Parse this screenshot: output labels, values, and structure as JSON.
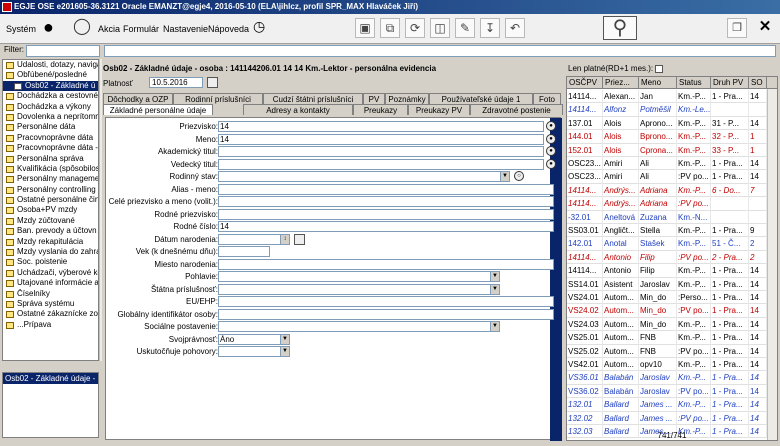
{
  "window": {
    "title": "EGJE OSE e201605-36.3121 Oracle EMANZT@egje4, 2016-05-10  (ELA\\jihlcz, profil SPR_MAX Hlaváček Jiří)"
  },
  "menu": {
    "system": "Systém",
    "akcia": "Akcia",
    "formular": "Formulár",
    "nastavenie": "Nastavenie",
    "napoveda": "Nápoveda"
  },
  "filter": {
    "label": "Filter:"
  },
  "nav_tree": [
    {
      "label": "Udalosti, dotazy, navigá",
      "level": 0
    },
    {
      "label": "Obľúbené/posledné",
      "level": 0
    },
    {
      "label": "Osb02 - Základné ú",
      "level": 1,
      "selected": true
    },
    {
      "label": "Dochádzka a cestovné",
      "level": 0
    },
    {
      "label": "Dochádzka a výkony",
      "level": 0
    },
    {
      "label": "Dovolenka a neprítomn",
      "level": 0
    },
    {
      "label": "Personálne dáta",
      "level": 0
    },
    {
      "label": "Pracovnoprávne dáta",
      "level": 0
    },
    {
      "label": "Pracovnoprávne dáta -",
      "level": 0
    },
    {
      "label": "Personálna správa",
      "level": 0
    },
    {
      "label": "Kvalifikácia (spôsobilost",
      "level": 0
    },
    {
      "label": "Personálny managemer",
      "level": 0
    },
    {
      "label": "Personálny controlling",
      "level": 0
    },
    {
      "label": "Ostatné personálne čin",
      "level": 0
    },
    {
      "label": "Osoba+PV mzdy",
      "level": 0
    },
    {
      "label": "Mzdy zúčtované",
      "level": 0
    },
    {
      "label": "Ban. prevody a účtovn",
      "level": 0
    },
    {
      "label": "Mzdy rekapitulácia",
      "level": 0
    },
    {
      "label": "Mzdy vyslania do zahran",
      "level": 0
    },
    {
      "label": "Soc. poistenie",
      "level": 0
    },
    {
      "label": "Uchádzači, výberové ko",
      "level": 0
    },
    {
      "label": "Utajované informácie a",
      "level": 0
    },
    {
      "label": "Číselníky",
      "level": 0
    },
    {
      "label": "Správa systému",
      "level": 0
    },
    {
      "label": "Ostatné zákaznícke zos",
      "level": 0
    },
    {
      "label": "...Prípava",
      "level": 0
    }
  ],
  "nav_bottom": {
    "current": "Osb02 - Základné údaje -"
  },
  "form": {
    "title": "Osb02 - Základné údaje - osoba : 141144206.01    14    14    Km.-Lektor - personálna evidencia",
    "platnost_label": "Platnosť",
    "platnost_value": "10.5.2016",
    "tabs_row1": [
      "Dôchodky a OZP",
      "Rodinní príslušníci",
      "Cudzí štátni príslušníci",
      "PV",
      "Poznámky",
      "Používateľské údaje 1",
      "Foto"
    ],
    "tabs_row2": [
      "Základné personálne údaje",
      "Adresy a kontakty",
      "Preukazy",
      "Preukazy PV",
      "Zdravotné postenie"
    ],
    "fields": [
      {
        "label": "Priezvisko:",
        "value": "14"
      },
      {
        "label": "Meno:",
        "value": "14"
      },
      {
        "label": "Akademický titul:",
        "value": ""
      },
      {
        "label": "Vedecký titul:",
        "value": ""
      },
      {
        "label": "Rodinný stav:",
        "value": ""
      },
      {
        "label": "Alias - meno:",
        "value": ""
      },
      {
        "label": "Celé priezvisko a meno (volit.):",
        "value": ""
      },
      {
        "label": "Rodné priezvisko:",
        "value": ""
      },
      {
        "label": "Rodné číslo:",
        "value": "14"
      },
      {
        "label": "Dátum narodenia:",
        "value": ""
      },
      {
        "label": "Vek (k dnešnému dňu):",
        "value": ""
      },
      {
        "label": "Miesto narodenia:",
        "value": ""
      },
      {
        "label": "Pohlavie:",
        "value": ""
      },
      {
        "label": "Štátna príslušnosť:",
        "value": ""
      },
      {
        "label": "EU/EHP:",
        "value": ""
      },
      {
        "label": "Globálny identifikátor osoby:",
        "value": ""
      },
      {
        "label": "Sociálne postavenie:",
        "value": ""
      },
      {
        "label": "Svojprávnosť:",
        "value": "Áno"
      },
      {
        "label": "Uskutočňuje pohovory:",
        "value": ""
      }
    ]
  },
  "grid": {
    "len_platne_label": "Len platné(RD+1 mes.):",
    "headers": [
      "OSČPV",
      "Priez...",
      "Meno",
      "Status",
      "Druh PV",
      "SO"
    ],
    "rows": [
      {
        "c": [
          "14114...",
          "Alexan...",
          "Jan",
          "Km.-P...",
          "1 - Pra...",
          "14"
        ],
        "color": "#000"
      },
      {
        "c": [
          "14114...",
          "Alfonz",
          "Potměšil",
          "Km.-Le...",
          "",
          ""
        ],
        "color": "#2040c0",
        "italic": true
      },
      {
        "c": [
          "137.01",
          "Alois",
          "Aprono...",
          "Km.-P...",
          "31 - P...",
          "14"
        ],
        "color": "#000"
      },
      {
        "c": [
          "144.01",
          "Alois",
          "Bprono...",
          "Km.-P...",
          "32 - P...",
          "1"
        ],
        "color": "#c00000"
      },
      {
        "c": [
          "152.01",
          "Alois",
          "Cprona...",
          "Km.-P...",
          "33 - P...",
          "1"
        ],
        "color": "#c00000"
      },
      {
        "c": [
          "OSC23...",
          "Amiri",
          "Ali",
          "Km.-P...",
          "1 - Pra...",
          "14"
        ],
        "color": "#000"
      },
      {
        "c": [
          "OSC23...",
          "Amiri",
          "Ali",
          ":PV po...",
          "1 - Pra...",
          "14"
        ],
        "color": "#000"
      },
      {
        "c": [
          "14114...",
          "Andrýs...",
          "Adriana",
          "Km.-P...",
          "6 - Do...",
          "7"
        ],
        "color": "#c00000",
        "italic": true
      },
      {
        "c": [
          "14114...",
          "Andrýs...",
          "Adriana",
          ":PV po...",
          "",
          ""
        ],
        "color": "#c00000",
        "italic": true
      },
      {
        "c": [
          "-32.01",
          "Aneltová",
          "Zuzana",
          "Km.-N...",
          "",
          ""
        ],
        "color": "#2040c0"
      },
      {
        "c": [
          "SS03.01",
          "Angličt...",
          "Stella",
          "Km.-P...",
          "1 - Pra...",
          "9"
        ],
        "color": "#000"
      },
      {
        "c": [
          "142.01",
          "Anotal",
          "Stašek",
          "Km.-P...",
          "51 - Č...",
          "2"
        ],
        "color": "#2040c0"
      },
      {
        "c": [
          "14114...",
          "Antonio",
          "Filip",
          ":PV po...",
          "2 - Pra...",
          "2"
        ],
        "color": "#c00000",
        "italic": true
      },
      {
        "c": [
          "14114...",
          "Antonio",
          "Filip",
          "Km.-P...",
          "1 - Pra...",
          "14"
        ],
        "color": "#000"
      },
      {
        "c": [
          "SS14.01",
          "Asistent",
          "Jaroslav",
          "Km.-P...",
          "1 - Pra...",
          "14"
        ],
        "color": "#000"
      },
      {
        "c": [
          "VS24.01",
          "Autom...",
          "Min_do",
          ":Perso...",
          "1 - Pra...",
          "14"
        ],
        "color": "#000"
      },
      {
        "c": [
          "VS24.02",
          "Autom...",
          "Min_do",
          ":PV po...",
          "1 - Pra...",
          "14"
        ],
        "color": "#c00000"
      },
      {
        "c": [
          "VS24.03",
          "Autom...",
          "Min_do",
          "Km.-P...",
          "1 - Pra...",
          "14"
        ],
        "color": "#000"
      },
      {
        "c": [
          "VS25.01",
          "Autom...",
          "FNB",
          "Km.-P...",
          "1 - Pra...",
          "14"
        ],
        "color": "#000"
      },
      {
        "c": [
          "VS25.02",
          "Autom...",
          "FNB",
          ":PV po...",
          "1 - Pra...",
          "14"
        ],
        "color": "#000"
      },
      {
        "c": [
          "VS42.01",
          "Autom...",
          "opv10",
          "Km.-P...",
          "1 - Pra...",
          "14"
        ],
        "color": "#000"
      },
      {
        "c": [
          "VS36.01",
          "Balabán",
          "Jaroslav",
          "Km.-P...",
          "1 - Pra...",
          "14"
        ],
        "color": "#2040c0",
        "italic": true
      },
      {
        "c": [
          "VS36.02",
          "Balabán",
          "Jaroslav",
          ":PV po...",
          "1 - Pra...",
          "14"
        ],
        "color": "#2040c0"
      },
      {
        "c": [
          "132.01",
          "Ballard",
          "James ...",
          "Km.-P...",
          "1 - Pra...",
          "14"
        ],
        "color": "#2040c0",
        "italic": true
      },
      {
        "c": [
          "132.02",
          "Ballard",
          "James ...",
          ":PV po...",
          "1 - Pra...",
          "14"
        ],
        "color": "#2040c0",
        "italic": true
      },
      {
        "c": [
          "132.03",
          "Ballard",
          "James ...",
          "Km.-P...",
          "1 - Pra...",
          "14"
        ],
        "color": "#2040c0",
        "italic": true
      }
    ],
    "footer": "741/741"
  }
}
